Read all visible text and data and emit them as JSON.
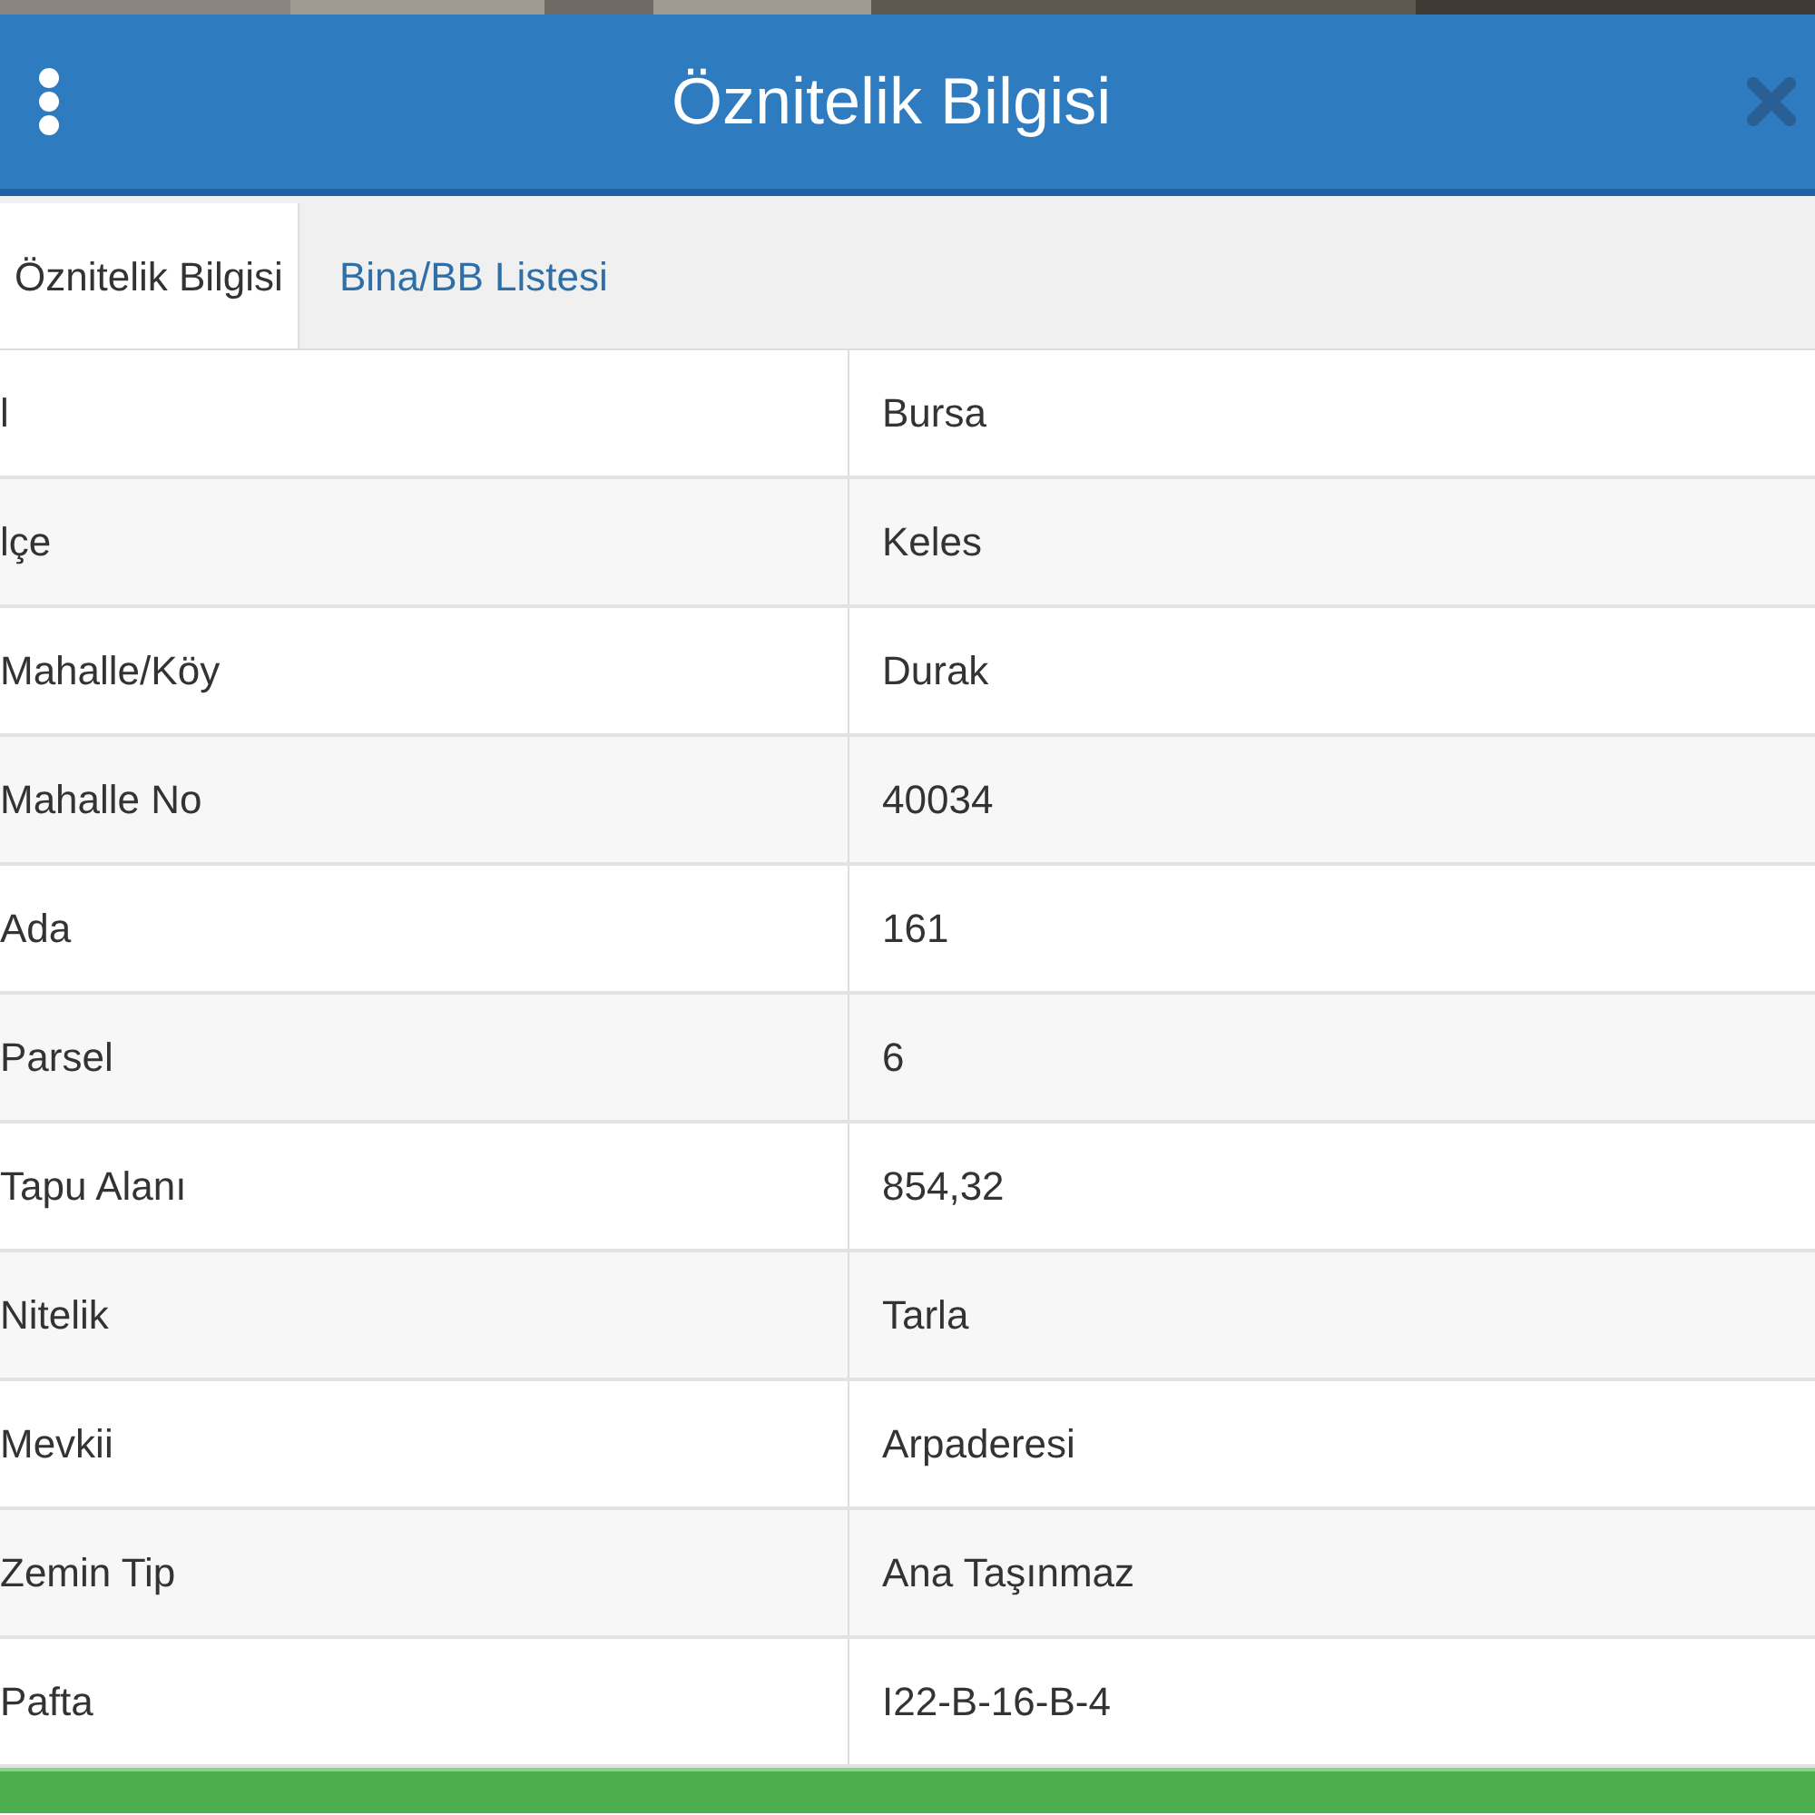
{
  "header": {
    "title": "Öznitelik Bilgisi"
  },
  "tabs": [
    {
      "label": "Öznitelik Bilgisi",
      "selected": true
    },
    {
      "label": "Bina/BB Listesi",
      "selected": false
    }
  ],
  "table": {
    "rows": [
      {
        "label": "l",
        "value": "Bursa"
      },
      {
        "label": "lçe",
        "value": "Keles"
      },
      {
        "label": "Mahalle/Köy",
        "value": "Durak"
      },
      {
        "label": "Mahalle No",
        "value": "40034"
      },
      {
        "label": "Ada",
        "value": "161"
      },
      {
        "label": "Parsel",
        "value": "6"
      },
      {
        "label": "Tapu Alanı",
        "value": "854,32"
      },
      {
        "label": "Nitelik",
        "value": "Tarla"
      },
      {
        "label": "Mevkii",
        "value": "Arpaderesi"
      },
      {
        "label": "Zemin Tip",
        "value": "Ana Taşınmaz"
      },
      {
        "label": "Pafta",
        "value": "I22-B-16-B-4"
      }
    ]
  }
}
